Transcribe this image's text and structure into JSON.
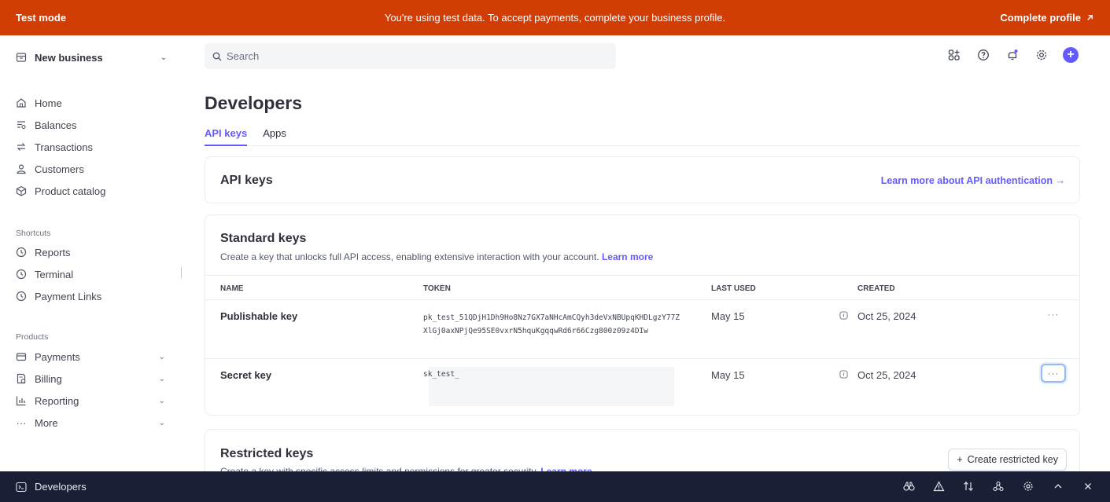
{
  "banner": {
    "mode": "Test mode",
    "message": "You're using test data. To accept payments, complete your business profile.",
    "cta": "Complete profile",
    "color": "#d13d04"
  },
  "sidebar": {
    "business": "New business",
    "main_items": [
      {
        "label": "Home",
        "icon": "home-icon"
      },
      {
        "label": "Balances",
        "icon": "balances-icon"
      },
      {
        "label": "Transactions",
        "icon": "transactions-icon"
      },
      {
        "label": "Customers",
        "icon": "customers-icon"
      },
      {
        "label": "Product catalog",
        "icon": "product-catalog-icon"
      }
    ],
    "shortcuts_label": "Shortcuts",
    "shortcuts": [
      {
        "label": "Reports",
        "icon": "clock-icon"
      },
      {
        "label": "Terminal",
        "icon": "clock-icon"
      },
      {
        "label": "Payment Links",
        "icon": "clock-icon"
      }
    ],
    "products_label": "Products",
    "products": [
      {
        "label": "Payments",
        "icon": "payments-icon"
      },
      {
        "label": "Billing",
        "icon": "billing-icon"
      },
      {
        "label": "Reporting",
        "icon": "reporting-icon"
      },
      {
        "label": "More",
        "icon": "more-dots-icon"
      }
    ]
  },
  "search": {
    "placeholder": "Search"
  },
  "page": {
    "title": "Developers",
    "tabs": [
      "API keys",
      "Apps"
    ]
  },
  "api_card": {
    "title": "API keys",
    "link": "Learn more about API authentication →"
  },
  "standard": {
    "title": "Standard keys",
    "description": "Create a key that unlocks full API access, enabling extensive interaction with your account.",
    "learn_more": "Learn more",
    "columns": [
      "NAME",
      "TOKEN",
      "LAST USED",
      "CREATED"
    ],
    "rows": [
      {
        "name": "Publishable key",
        "token": "pk_test_51QDjH1Dh9Ho8Nz7GX7aNHcAmCQyh3deVxNBUpqKHDLgzY77ZXlGj0axNPjQe95SE0vxrN5hquKgqqwRd6r66Czg800z09z4DIw",
        "last_used": "May 15",
        "created": "Oct 25, 2024"
      },
      {
        "name": "Secret key",
        "token": "sk_test_",
        "last_used": "May 15",
        "created": "Oct 25, 2024"
      }
    ]
  },
  "restricted": {
    "title": "Restricted keys",
    "description": "Create a key with specific access limits and permissions for greater security.",
    "learn_more": "Learn more",
    "button": "Create restricted key"
  },
  "bottombar": {
    "label": "Developers"
  },
  "accent": "#635bff"
}
